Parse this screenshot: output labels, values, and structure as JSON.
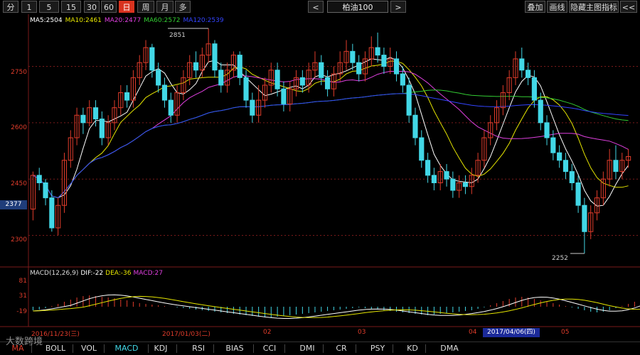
{
  "toolbar": {
    "periods": [
      "分",
      "1",
      "5",
      "15",
      "30",
      "60",
      "日",
      "周",
      "月",
      "多"
    ],
    "active_period": "日",
    "prev_label": "<",
    "next_label": ">",
    "symbol": "柏油100",
    "right_buttons": [
      "叠加",
      "画线",
      "隐藏主图指标",
      "<<",
      ">>"
    ]
  },
  "main_legend": {
    "items": [
      {
        "text": "MA5:2504",
        "color": "#ffffff"
      },
      {
        "text": "MA10:2461",
        "color": "#e6e600"
      },
      {
        "text": "MA20:2477",
        "color": "#e040e0"
      },
      {
        "text": "MA60:2572",
        "color": "#33cc33"
      },
      {
        "text": "MA120:2539",
        "color": "#3344ff"
      }
    ]
  },
  "y_axis_labels": [
    "2750",
    "2600",
    "2450",
    "2300"
  ],
  "current_price": "2377",
  "annotations": {
    "high": "2851",
    "low": "2252"
  },
  "macd_legend": {
    "items": [
      {
        "text": "MACD(12,26,9)",
        "color": "#dddddd"
      },
      {
        "text": "DIF:-22",
        "color": "#ffffff"
      },
      {
        "text": "DEA:-36",
        "color": "#e6e600"
      },
      {
        "text": "MACD:27",
        "color": "#e040e0"
      }
    ]
  },
  "macd_y_labels": [
    "81",
    "31",
    "-19"
  ],
  "date_labels": [
    "2016/11/23(三)",
    "2017/01/03(二)",
    "02",
    "03",
    "04",
    "05"
  ],
  "cursor_date": "2017/04/06(四)",
  "bottom_tabs": [
    "MA",
    "BOLL",
    "VOL",
    "MACD",
    "KDJ",
    "RSI",
    "BIAS",
    "CCI",
    "DMI",
    "CR",
    "PSY",
    "KD",
    "DMA"
  ],
  "active_tab": "MACD",
  "watermark": "大数跨境",
  "colors": {
    "up": "#e03c2b",
    "down": "#42d7e6",
    "grid": "#7a1a1a"
  },
  "chart_data": {
    "type": "candlestick",
    "ylim": [
      2250,
      2870
    ],
    "candles": [
      [
        2370,
        2460,
        2340,
        2470
      ],
      [
        2460,
        2440,
        2420,
        2480
      ],
      [
        2440,
        2400,
        2380,
        2450
      ],
      [
        2400,
        2320,
        2310,
        2420
      ],
      [
        2320,
        2380,
        2300,
        2400
      ],
      [
        2380,
        2500,
        2360,
        2520
      ],
      [
        2500,
        2560,
        2480,
        2580
      ],
      [
        2560,
        2620,
        2540,
        2640
      ],
      [
        2620,
        2600,
        2570,
        2640
      ],
      [
        2600,
        2640,
        2590,
        2660
      ],
      [
        2640,
        2610,
        2590,
        2660
      ],
      [
        2610,
        2560,
        2540,
        2630
      ],
      [
        2560,
        2600,
        2540,
        2620
      ],
      [
        2600,
        2640,
        2580,
        2660
      ],
      [
        2640,
        2680,
        2620,
        2700
      ],
      [
        2680,
        2660,
        2640,
        2700
      ],
      [
        2660,
        2720,
        2640,
        2740
      ],
      [
        2720,
        2760,
        2700,
        2780
      ],
      [
        2760,
        2800,
        2740,
        2820
      ],
      [
        2800,
        2740,
        2720,
        2810
      ],
      [
        2740,
        2700,
        2680,
        2760
      ],
      [
        2700,
        2660,
        2640,
        2720
      ],
      [
        2660,
        2620,
        2600,
        2680
      ],
      [
        2620,
        2680,
        2600,
        2700
      ],
      [
        2680,
        2720,
        2660,
        2740
      ],
      [
        2720,
        2760,
        2700,
        2780
      ],
      [
        2760,
        2740,
        2720,
        2790
      ],
      [
        2740,
        2780,
        2720,
        2800
      ],
      [
        2780,
        2810,
        2760,
        2851
      ],
      [
        2810,
        2740,
        2720,
        2820
      ],
      [
        2740,
        2700,
        2680,
        2760
      ],
      [
        2700,
        2740,
        2680,
        2760
      ],
      [
        2740,
        2780,
        2720,
        2790
      ],
      [
        2780,
        2720,
        2700,
        2790
      ],
      [
        2720,
        2660,
        2640,
        2740
      ],
      [
        2660,
        2620,
        2600,
        2680
      ],
      [
        2620,
        2660,
        2600,
        2700
      ],
      [
        2660,
        2700,
        2640,
        2720
      ],
      [
        2700,
        2740,
        2680,
        2760
      ],
      [
        2740,
        2690,
        2670,
        2760
      ],
      [
        2690,
        2650,
        2630,
        2710
      ],
      [
        2650,
        2690,
        2630,
        2710
      ],
      [
        2690,
        2720,
        2670,
        2740
      ],
      [
        2720,
        2700,
        2680,
        2740
      ],
      [
        2700,
        2740,
        2680,
        2760
      ],
      [
        2740,
        2760,
        2720,
        2790
      ],
      [
        2760,
        2720,
        2700,
        2780
      ],
      [
        2720,
        2690,
        2670,
        2740
      ],
      [
        2690,
        2730,
        2670,
        2750
      ],
      [
        2730,
        2760,
        2710,
        2790
      ],
      [
        2760,
        2790,
        2740,
        2820
      ],
      [
        2790,
        2760,
        2740,
        2810
      ],
      [
        2760,
        2730,
        2710,
        2780
      ],
      [
        2730,
        2770,
        2710,
        2790
      ],
      [
        2770,
        2800,
        2750,
        2830
      ],
      [
        2800,
        2780,
        2760,
        2840
      ],
      [
        2780,
        2750,
        2730,
        2800
      ],
      [
        2750,
        2770,
        2730,
        2800
      ],
      [
        2770,
        2730,
        2710,
        2790
      ],
      [
        2730,
        2700,
        2680,
        2750
      ],
      [
        2700,
        2620,
        2600,
        2720
      ],
      [
        2620,
        2560,
        2540,
        2640
      ],
      [
        2560,
        2500,
        2480,
        2580
      ],
      [
        2500,
        2460,
        2440,
        2520
      ],
      [
        2460,
        2440,
        2420,
        2480
      ],
      [
        2440,
        2470,
        2420,
        2490
      ],
      [
        2470,
        2450,
        2430,
        2490
      ],
      [
        2450,
        2420,
        2400,
        2470
      ],
      [
        2420,
        2440,
        2400,
        2460
      ],
      [
        2440,
        2430,
        2410,
        2460
      ],
      [
        2430,
        2460,
        2410,
        2480
      ],
      [
        2460,
        2500,
        2440,
        2520
      ],
      [
        2500,
        2560,
        2480,
        2580
      ],
      [
        2560,
        2600,
        2540,
        2620
      ],
      [
        2600,
        2640,
        2580,
        2660
      ],
      [
        2640,
        2680,
        2620,
        2700
      ],
      [
        2680,
        2720,
        2660,
        2740
      ],
      [
        2720,
        2770,
        2700,
        2790
      ],
      [
        2770,
        2740,
        2720,
        2800
      ],
      [
        2740,
        2720,
        2700,
        2760
      ],
      [
        2720,
        2660,
        2640,
        2740
      ],
      [
        2660,
        2600,
        2580,
        2680
      ],
      [
        2600,
        2560,
        2540,
        2620
      ],
      [
        2560,
        2520,
        2500,
        2580
      ],
      [
        2520,
        2500,
        2480,
        2540
      ],
      [
        2500,
        2470,
        2450,
        2520
      ],
      [
        2470,
        2440,
        2420,
        2490
      ],
      [
        2440,
        2380,
        2360,
        2460
      ],
      [
        2380,
        2310,
        2252,
        2400
      ],
      [
        2310,
        2360,
        2290,
        2380
      ],
      [
        2360,
        2400,
        2340,
        2420
      ],
      [
        2400,
        2450,
        2380,
        2470
      ],
      [
        2450,
        2500,
        2430,
        2530
      ],
      [
        2500,
        2470,
        2450,
        2540
      ],
      [
        2470,
        2500,
        2450,
        2520
      ],
      [
        2500,
        2510,
        2480,
        2530
      ]
    ],
    "macd_hist": [
      -10,
      -8,
      -4,
      2,
      8,
      14,
      20,
      26,
      30,
      32,
      30,
      28,
      26,
      24,
      20,
      18,
      14,
      10,
      8,
      6,
      4,
      2,
      0,
      -2,
      -4,
      -6,
      -8,
      -10,
      -12,
      -14,
      -16,
      -18,
      -20,
      -22,
      -24,
      -26,
      -28,
      -30,
      -30,
      -28,
      -26,
      -24,
      -22,
      -20,
      -18,
      -16,
      -14,
      -12,
      -10,
      -8,
      -6,
      -4,
      -2,
      -4,
      -6,
      -8,
      -10,
      -12,
      -14,
      -16,
      -18,
      -20,
      -22,
      -24,
      -22,
      -20,
      -18,
      -16,
      -14,
      -12,
      -10,
      -6,
      -2,
      4,
      10,
      16,
      22,
      26,
      28,
      26,
      22,
      18,
      14,
      10,
      6,
      2,
      -2,
      -6,
      -10,
      -14,
      -16,
      -14,
      -10,
      -4,
      2,
      8,
      14,
      20,
      27
    ]
  }
}
